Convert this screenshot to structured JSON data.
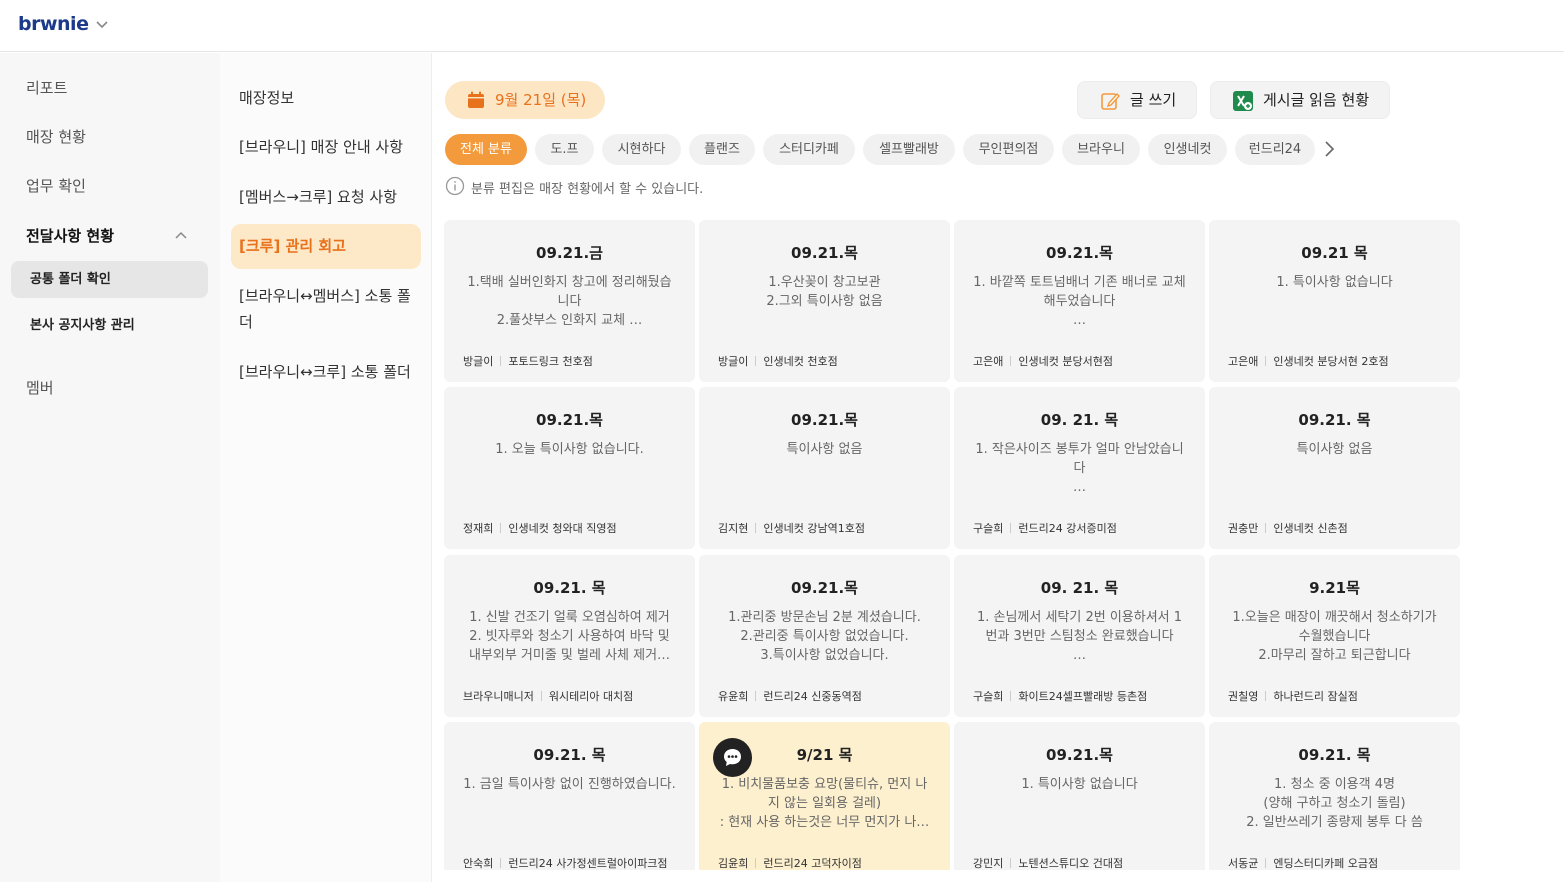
{
  "app": {
    "logo": "brwnie"
  },
  "sidebar": {
    "items": [
      {
        "label": "리포트"
      },
      {
        "label": "매장 현황"
      },
      {
        "label": "업무 확인"
      },
      {
        "label": "전달사항 현황"
      },
      {
        "label": "멤버"
      }
    ],
    "subitems": [
      {
        "label": "공통 폴더 확인"
      },
      {
        "label": "본사 공지사항 관리"
      }
    ]
  },
  "folders": [
    {
      "label": "매장정보"
    },
    {
      "label": "[브라우니] 매장 안내 사항"
    },
    {
      "label": "[멤버스→크루] 요청 사항"
    },
    {
      "label": "[크루] 관리 회고"
    },
    {
      "label": "[브라우니↔멤버스] 소통 폴더"
    },
    {
      "label": "[브라우니↔크루] 소통 폴더"
    }
  ],
  "toolbar": {
    "date": "9월 21일 (목)",
    "write_label": "글 쓰기",
    "read_status_label": "게시글 읽음 현황"
  },
  "filters": {
    "chips": [
      "전체 분류",
      "도.프",
      "시현하다",
      "플랜즈",
      "스터디카페",
      "셀프빨래방",
      "무인편의점",
      "브라우니",
      "인생네컷",
      "런드리24"
    ],
    "info": "분류 편집은 매장 현황에서 할 수 있습니다."
  },
  "cards": [
    {
      "date": "09.21.금",
      "body": "1.택배 실버인화지 창고에 정리해뒀습\n니다\n2.풀샷부스 인화지 교체 …",
      "author": "방글이",
      "store": "포토드링크 천호점"
    },
    {
      "date": "09.21.목",
      "body": "1.우산꽂이 창고보관\n2.그외 특이사항 없음",
      "author": "방글이",
      "store": "인생네컷 천호점"
    },
    {
      "date": "09.21.목",
      "body": "1. 바깥쪽 토트넘배너 기존 배너로 교체\n해두었습니다\n…",
      "author": "고은애",
      "store": "인생네컷 분당서현점"
    },
    {
      "date": "09.21 목",
      "body": "1. 특이사항 없습니다",
      "author": "고은애",
      "store": "인생네컷 분당서현 2호점"
    },
    {
      "date": "09.21.목",
      "body": "1. 오늘 특이사항 없습니다.",
      "author": "정재희",
      "store": "인생네컷 청와대 직영점"
    },
    {
      "date": "09.21.목",
      "body": "특이사항 없음",
      "author": "김지현",
      "store": "인생네컷 강남역1호점"
    },
    {
      "date": "09. 21. 목",
      "body": "1. 작은사이즈 봉투가 얼마 안남았습니\n다\n…",
      "author": "구슬희",
      "store": "런드리24 강서증미점"
    },
    {
      "date": "09.21. 목",
      "body": "특이사항 없음",
      "author": "권충만",
      "store": "인생네컷 신촌점"
    },
    {
      "date": "09.21. 목",
      "body": "1. 신발 건조기 얼룩 오염심하여 제거\n2. 빗자루와 청소기 사용하여 바닥 및\n내부외부 거미줄 및 벌레 사체 제거…",
      "author": "브라우니매니저",
      "store": "워시테리아 대치점"
    },
    {
      "date": "09.21.목",
      "body": "1.관리중 방문손님 2분 계셨습니다.\n2.관리중 특이사항 없었습니다.\n3.특이사항 없었습니다.",
      "author": "유윤희",
      "store": "런드리24 신중동역점"
    },
    {
      "date": "09. 21. 목",
      "body": "1. 손님께서 세탁기 2번 이용하셔서 1\n번과 3번만 스팀청소 완료했습니다\n…",
      "author": "구슬희",
      "store": "화이트24셀프빨래방 등촌점"
    },
    {
      "date": "9.21목",
      "body": "1.오늘은 매장이 깨끗해서 청소하기가\n수월했습니다\n2.마무리 잘하고 퇴근합니다",
      "author": "권칠영",
      "store": "하나런드리 잠실점"
    },
    {
      "date": "09.21. 목",
      "body": "1. 금일 특이사항 없이 진행하였습니다.",
      "author": "안숙희",
      "store": "런드리24 사가정센트럴아이파크점"
    },
    {
      "date": "9/21 목",
      "body": "1. 비치물품보충 요망(물티슈, 먼지 나\n지 않는 일회용 걸레)\n: 현재 사용 하는것은 너무 먼지가 나…",
      "author": "김윤희",
      "store": "런드리24 고덕자이점"
    },
    {
      "date": "09.21.목",
      "body": "1. 특이사항 없습니다",
      "author": "강민지",
      "store": "노텐션스튜디오 건대점"
    },
    {
      "date": "09.21. 목",
      "body": "1. 청소 중 이용객 4명\n(양해 구하고 청소기 돌림)\n2. 일반쓰레기 종량제 봉투 다 씀",
      "author": "서동균",
      "store": "엔딩스터디카페 오금점"
    }
  ],
  "colors": {
    "accent": "#f39a3c",
    "accent_text": "#e8711c",
    "active_folder_bg": "#fde8c7",
    "highlight_card": "#fdf0cf"
  }
}
